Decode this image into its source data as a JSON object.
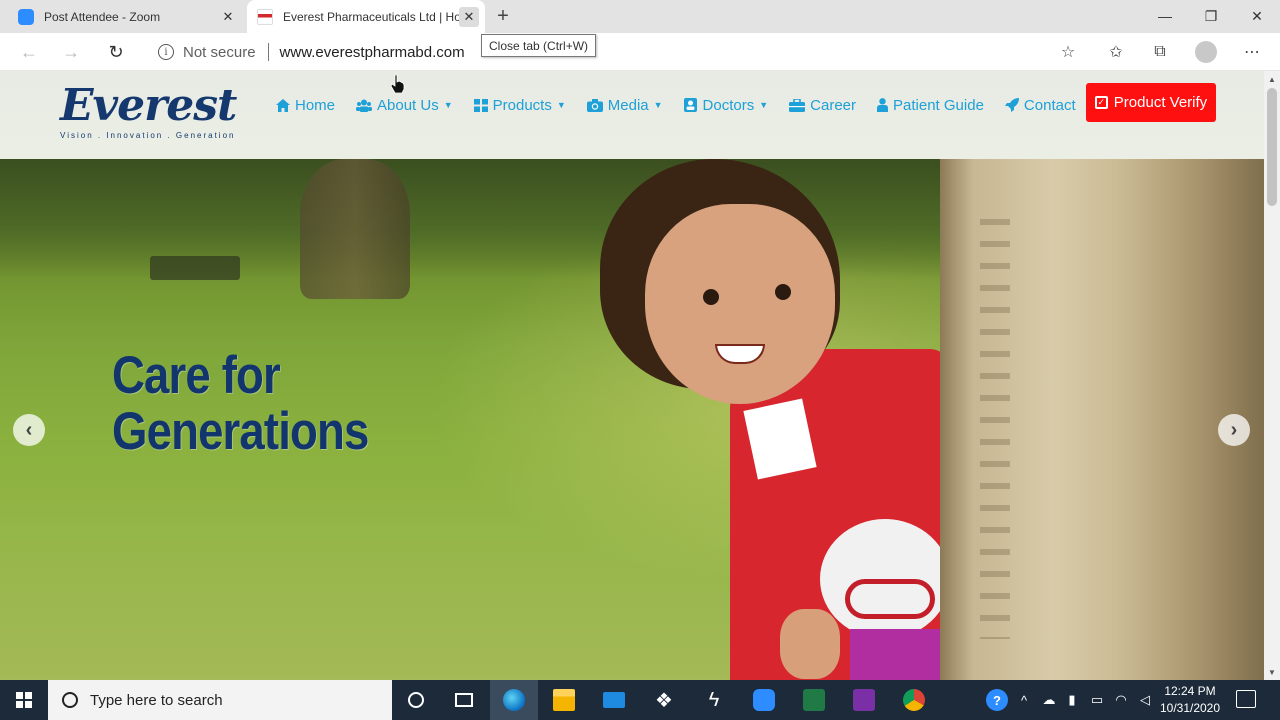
{
  "browser": {
    "tabs": [
      {
        "title": "Post Attendee - Zoom",
        "favicon_color": "#2d8cff"
      },
      {
        "title": "Everest Pharmaceuticals Ltd | Ho",
        "favicon_color": "#d12a2a"
      }
    ],
    "tooltip": "Close tab (Ctrl+W)",
    "security_label": "Not secure",
    "url": "www.everestpharmabd.com"
  },
  "site": {
    "logo": {
      "word": "Everest",
      "tagline": "Vision . Innovation . Generation"
    },
    "nav": [
      {
        "label": "Home",
        "icon": "home-icon",
        "dropdown": false
      },
      {
        "label": "About Us",
        "icon": "users-icon",
        "dropdown": true
      },
      {
        "label": "Products",
        "icon": "grid-icon",
        "dropdown": true
      },
      {
        "label": "Media",
        "icon": "camera-icon",
        "dropdown": true
      },
      {
        "label": "Doctors",
        "icon": "doctor-icon",
        "dropdown": true
      },
      {
        "label": "Career",
        "icon": "briefcase-icon",
        "dropdown": false
      },
      {
        "label": "Patient Guide",
        "icon": "person-icon",
        "dropdown": false
      },
      {
        "label": "Contact",
        "icon": "rocket-icon",
        "dropdown": false
      }
    ],
    "verify_button": "Product Verify",
    "hero": {
      "line1": "Care for",
      "line2": "Generations"
    },
    "colors": {
      "nav_link": "#1ea0d8",
      "verify_bg": "#ff1010",
      "brand_navy": "#15396e"
    }
  },
  "taskbar": {
    "search_placeholder": "Type here to search",
    "time": "12:24 PM",
    "date": "10/31/2020"
  }
}
